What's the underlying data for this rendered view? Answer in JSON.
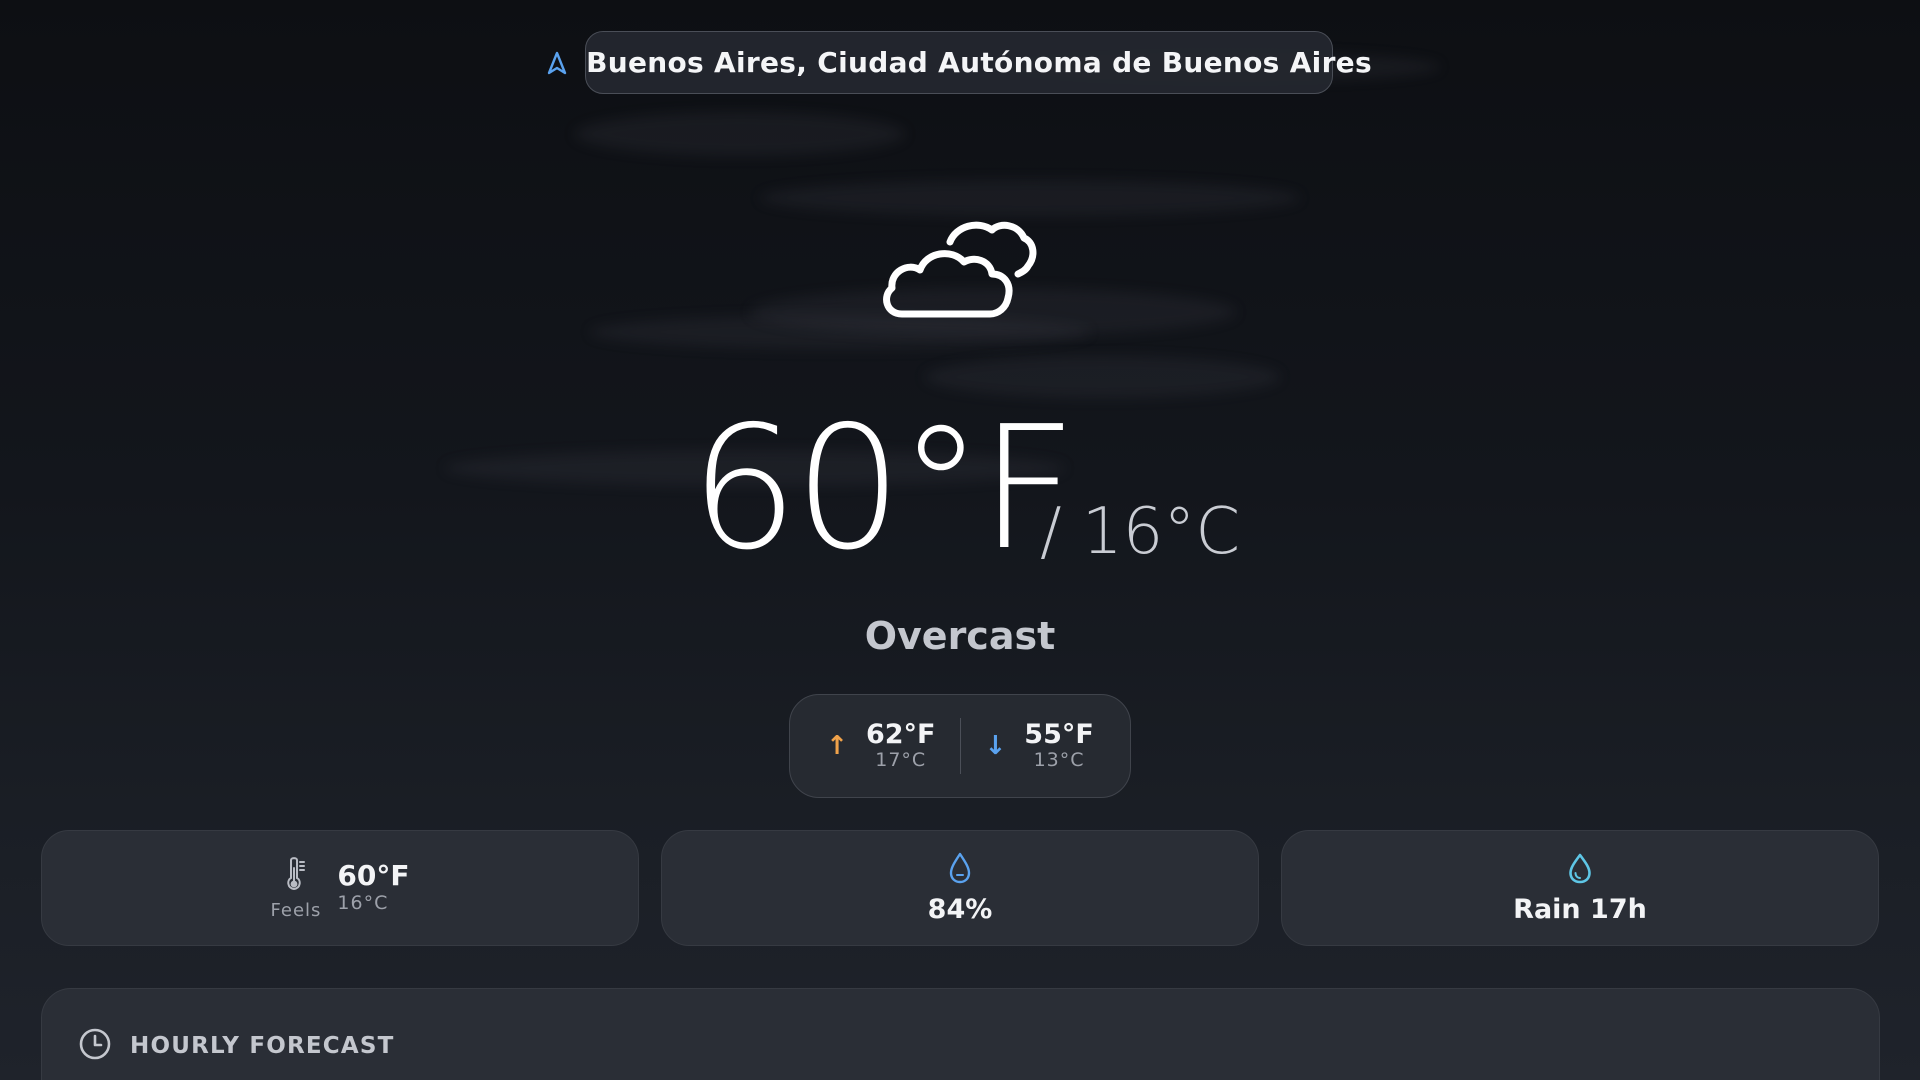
{
  "location": {
    "name": "Buenos Aires, Ciudad Autónoma de Buenos Aires",
    "icon": "navigation-arrow-icon"
  },
  "current": {
    "icon": "cloud-icon",
    "temp_f": "60°F",
    "temp_c": "/ 16°C",
    "condition": "Overcast"
  },
  "hilo": {
    "high_arrow": "↑",
    "high_f": "62°F",
    "high_c": "17°C",
    "low_arrow": "↓",
    "low_f": "55°F",
    "low_c": "13°C"
  },
  "cards": {
    "feels": {
      "icon": "thermometer-icon",
      "label": "Feels",
      "value_f": "60°F",
      "value_c": "16°C"
    },
    "humidity": {
      "icon": "humidity-drop-icon",
      "value": "84%"
    },
    "rain": {
      "icon": "rain-drop-icon",
      "value": "Rain 17h"
    }
  },
  "hourly": {
    "icon": "clock-icon",
    "title": "HOURLY FORECAST"
  },
  "colors": {
    "accent_blue": "#5aa2ef",
    "high_orange": "#f0a24a",
    "drop_cyan": "#5ec6e6"
  }
}
